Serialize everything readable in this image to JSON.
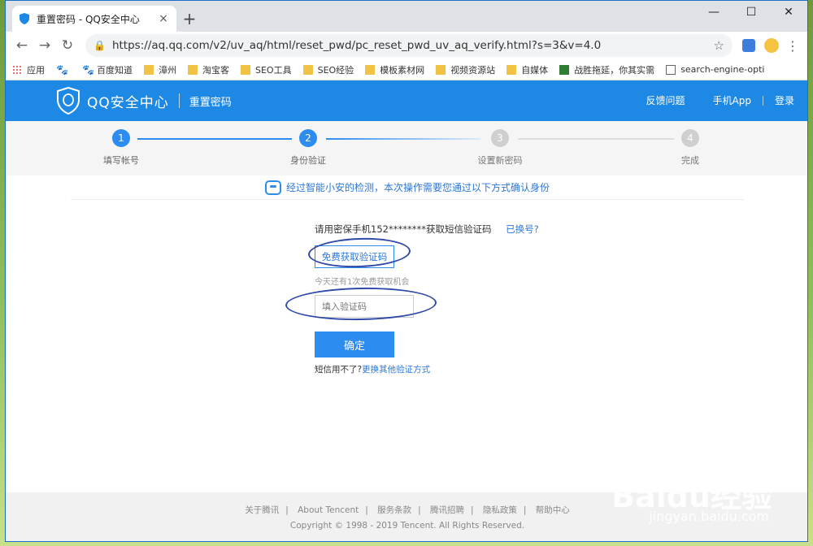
{
  "browser": {
    "tab_title": "重置密码 - QQ安全中心",
    "new_tab": "+",
    "close_tab": "×",
    "url": "https://aq.qq.com/v2/uv_aq/html/reset_pwd/pc_reset_pwd_uv_aq_verify.html?s=3&v=4.0",
    "window_controls": {
      "minimize": "—",
      "maximize": "☐",
      "close": "✕"
    },
    "nav": {
      "back": "←",
      "forward": "→",
      "reload": "↻"
    },
    "bookmarks": [
      {
        "label": "应用",
        "icon": "apps-icon"
      },
      {
        "label": "",
        "icon": "paw-icon"
      },
      {
        "label": "百度知道",
        "icon": "paw-icon"
      },
      {
        "label": "漳州",
        "icon": "folder-icon"
      },
      {
        "label": "淘宝客",
        "icon": "folder-icon"
      },
      {
        "label": "SEO工具",
        "icon": "folder-icon"
      },
      {
        "label": "SEO经验",
        "icon": "folder-icon"
      },
      {
        "label": "模板素材网",
        "icon": "folder-icon"
      },
      {
        "label": "视频资源站",
        "icon": "folder-icon"
      },
      {
        "label": "自媒体",
        "icon": "folder-icon"
      },
      {
        "label": "战胜拖延，你其实需",
        "icon": "douban-icon"
      },
      {
        "label": "search-engine-opti",
        "icon": "doc-icon"
      }
    ]
  },
  "header": {
    "brand": "QQ安全中心",
    "section": "重置密码",
    "nav": {
      "feedback": "反馈问题",
      "app": "手机App",
      "login": "登录"
    }
  },
  "steps": [
    {
      "num": "1",
      "label": "填写帐号",
      "state": "active"
    },
    {
      "num": "2",
      "label": "身份验证",
      "state": "active"
    },
    {
      "num": "3",
      "label": "设置新密码",
      "state": "inactive"
    },
    {
      "num": "4",
      "label": "完成",
      "state": "inactive"
    }
  ],
  "notice": "经过智能小安的检测，本次操作需要您通过以下方式确认身份",
  "verify": {
    "prompt": "请用密保手机152********获取短信验证码",
    "change_number": "已换号?",
    "get_code_button": "免费获取验证码",
    "remaining": "今天还有1次免费获取机会",
    "code_placeholder": "填入验证码",
    "confirm_button": "确定",
    "alt_prefix": "短信用不了?",
    "alt_link": "更换其他验证方式"
  },
  "footer": {
    "links": [
      "关于腾讯",
      "About Tencent",
      "服务条款",
      "腾讯招聘",
      "隐私政策",
      "帮助中心"
    ],
    "copyright": "Copyright © 1998 - 2019 Tencent. All Rights Reserved."
  },
  "watermark": {
    "brand": "Baidu经验",
    "url": "jingyan.baidu.com"
  },
  "colors": {
    "primary": "#2d8cf0",
    "header": "#1e88e5",
    "annotation": "#2f49a8"
  }
}
